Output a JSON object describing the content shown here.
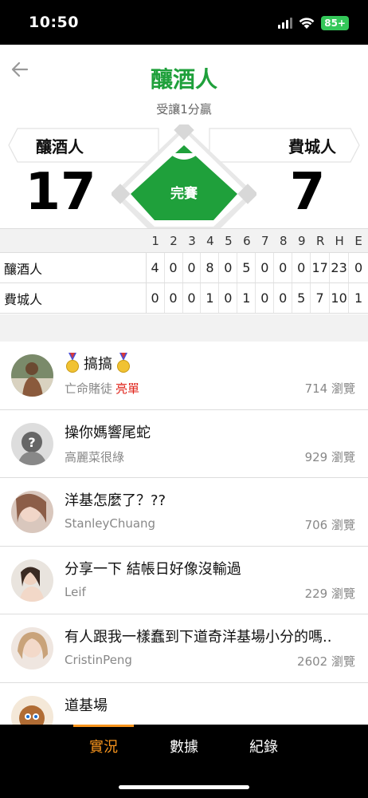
{
  "status_bar": {
    "time": "10:50",
    "battery": "85+"
  },
  "header": {
    "title": "釀酒人",
    "subtitle": "受讓1分贏"
  },
  "scoreboard": {
    "away_team": "釀酒人",
    "home_team": "費城人",
    "away_score": "17",
    "home_score": "7",
    "game_status": "完賽"
  },
  "colors": {
    "accent_green": "#1fa03b",
    "tab_active": "#f7941d",
    "highlight_red": "#e0241b"
  },
  "innings": {
    "headers": [
      "1",
      "2",
      "3",
      "4",
      "5",
      "6",
      "7",
      "8",
      "9",
      "R",
      "H",
      "E"
    ],
    "rows": [
      {
        "team": "釀酒人",
        "cells": [
          "4",
          "0",
          "0",
          "8",
          "0",
          "5",
          "0",
          "0",
          "0",
          "17",
          "23",
          "0"
        ]
      },
      {
        "team": "費城人",
        "cells": [
          "0",
          "0",
          "0",
          "1",
          "0",
          "1",
          "0",
          "0",
          "5",
          "7",
          "10",
          "1"
        ]
      }
    ]
  },
  "posts": [
    {
      "title": "搞搞",
      "author": "亡命賭徒",
      "author_badge": "亮單",
      "views": "714 瀏覽",
      "icon": "medal-icon"
    },
    {
      "title": "操你媽響尾蛇",
      "author": "高麗菜很綠",
      "views": "929 瀏覽"
    },
    {
      "title": "洋基怎麼了？??",
      "author": "StanleyChuang",
      "views": "706 瀏覽"
    },
    {
      "title": "分享一下 結帳日好像沒輸過",
      "author": "Leif",
      "views": "229 瀏覽"
    },
    {
      "title": "有人跟我一樣蠢到下道奇洋基場小分的嗎..",
      "author": "CristinPeng",
      "views": "2602 瀏覽"
    },
    {
      "title": "道基場",
      "author": "",
      "views": ""
    }
  ],
  "tabs": [
    {
      "label": "實況",
      "active": true
    },
    {
      "label": "數據",
      "active": false
    },
    {
      "label": "紀錄",
      "active": false
    }
  ]
}
